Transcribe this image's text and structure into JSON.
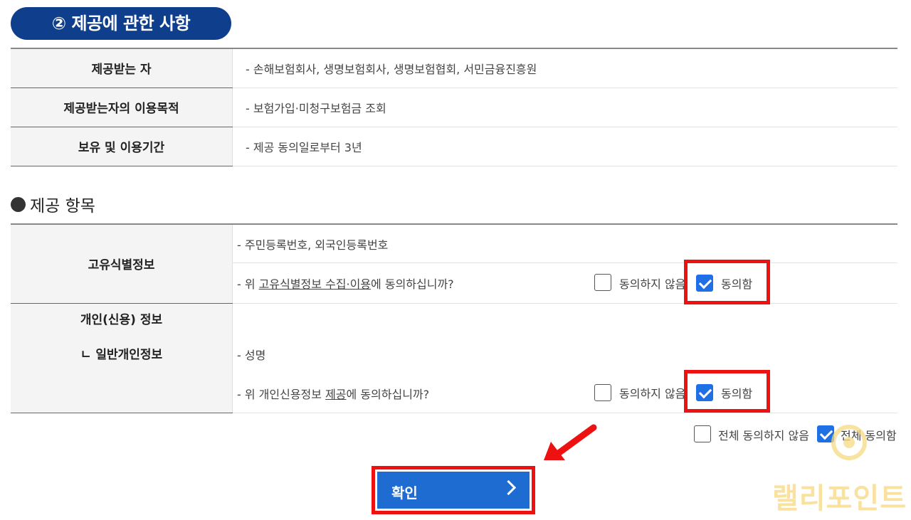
{
  "section_title": "② 제공에 관한 사항",
  "info_rows": [
    {
      "label": "제공받는 자",
      "value": "- 손해보험회사, 생명보험회사, 생명보험협회, 서민금융진흥원"
    },
    {
      "label": "제공받는자의 이용목적",
      "value": "- 보험가입·미청구보험금 조회"
    },
    {
      "label": "보유 및 이용기간",
      "value": "- 제공 동의일로부터 3년"
    }
  ],
  "items_heading": "제공 항목",
  "unique_id": {
    "label": "고유식별정보",
    "item_text": "- 주민등록번호, 외국인등록번호",
    "question_pre": "- 위 ",
    "question_link": "고유식별정보 수집·이용",
    "question_post": "에 동의하십니까?",
    "disagree_label": "동의하지 않음",
    "agree_label": "동의함",
    "agree_checked": true,
    "disagree_checked": false
  },
  "personal": {
    "label_main": "개인(신용) 정보",
    "label_sub": "ㄴ 일반개인정보",
    "item_text": "- 성명",
    "question_pre": "- 위 개인신용정보 ",
    "question_link": "제공",
    "question_post": "에 동의하십니까?",
    "disagree_label": "동의하지 않음",
    "agree_label": "동의함",
    "agree_checked": true,
    "disagree_checked": false
  },
  "all": {
    "disagree_label": "전체 동의하지 않음",
    "agree_label": "전체 동의함",
    "agree_checked": true
  },
  "confirm_label": "확인",
  "watermark": "랠리포인트",
  "colors": {
    "primary": "#1e6bd2",
    "header_navy": "#0f3f8c",
    "highlight": "#ee1111"
  }
}
